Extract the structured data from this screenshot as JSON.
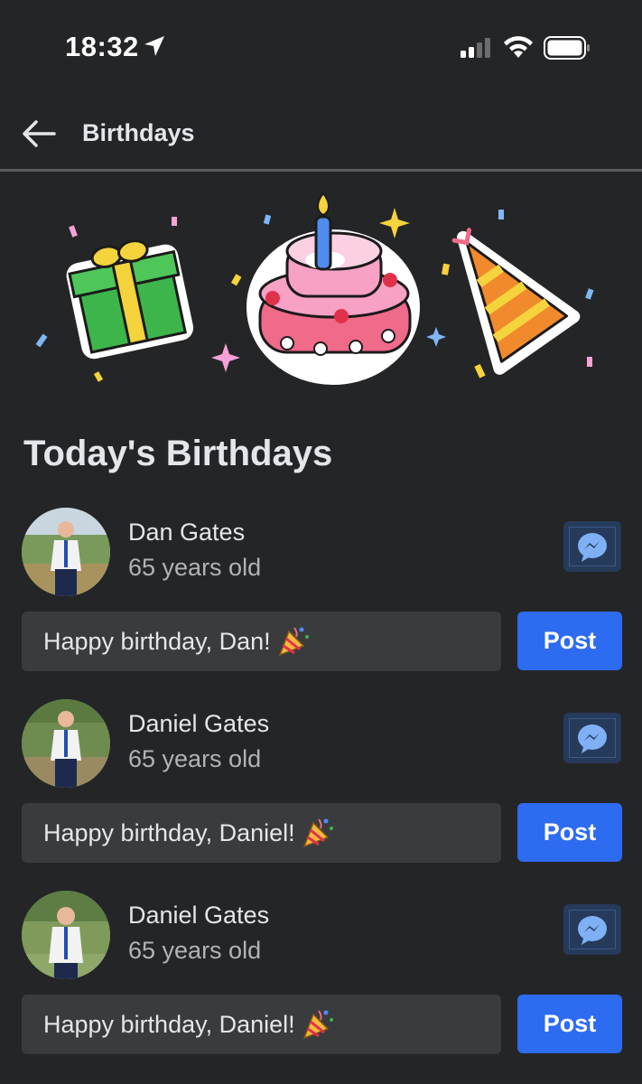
{
  "status_bar": {
    "time": "18:32"
  },
  "header": {
    "title": "Birthdays"
  },
  "section": {
    "title": "Today's Birthdays"
  },
  "entries": [
    {
      "name": "Dan Gates",
      "age": "65 years old",
      "message": "Happy birthday, Dan!",
      "post_label": "Post"
    },
    {
      "name": "Daniel Gates",
      "age": "65 years old",
      "message": "Happy birthday, Daniel!",
      "post_label": "Post"
    },
    {
      "name": "Daniel Gates",
      "age": "65 years old",
      "message": "Happy birthday, Daniel!",
      "post_label": "Post"
    }
  ],
  "icons": {
    "back": "back-arrow-icon",
    "messenger": "messenger-icon",
    "popper": "party-popper-icon"
  },
  "colors": {
    "background": "#242527",
    "post_button": "#2d6bf0",
    "input_bg": "#3a3b3c"
  }
}
